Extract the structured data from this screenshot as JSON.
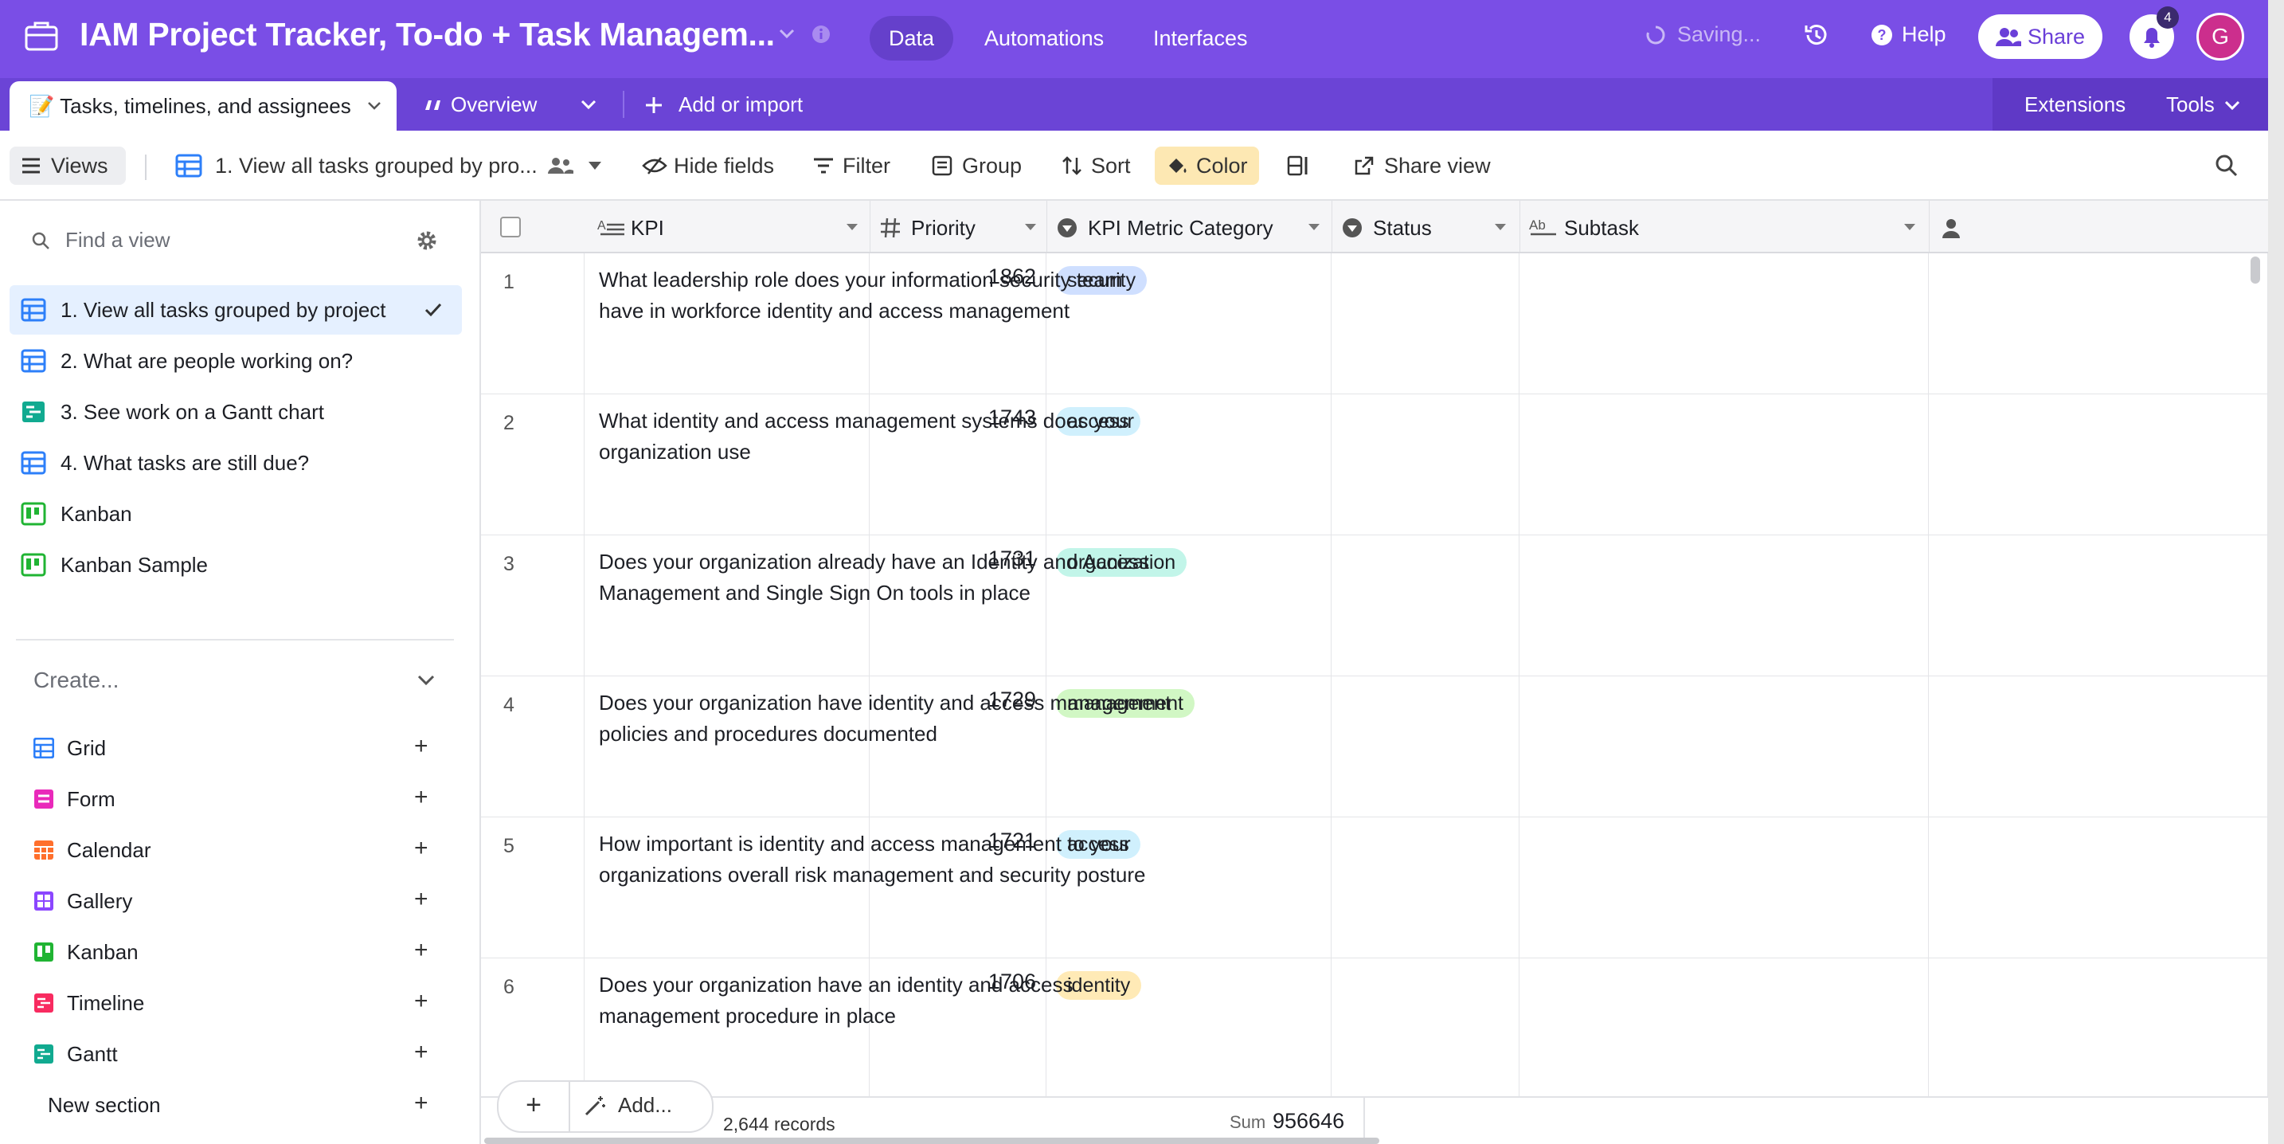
{
  "topbar": {
    "base_title": "IAM Project Tracker, To-do + Task Managem...",
    "nav": [
      "Data",
      "Automations",
      "Interfaces"
    ],
    "saving_text": "Saving...",
    "help_label": "Help",
    "share_label": "Share",
    "notifications_count": "4",
    "avatar_initial": "G",
    "brand_color": "#7a4ee6"
  },
  "tabbar": {
    "active_tab": "📝 Tasks, timelines, and assignees",
    "overview_tab": "Overview",
    "add_import": "Add or import",
    "extensions": "Extensions",
    "tools": "Tools"
  },
  "viewbar": {
    "views_label": "Views",
    "current_view": "1. View all tasks grouped by pro...",
    "hide_fields": "Hide fields",
    "filter": "Filter",
    "group": "Group",
    "sort": "Sort",
    "color": "Color",
    "share_view": "Share view"
  },
  "sidebar": {
    "find_placeholder": "Find a view",
    "views": [
      {
        "label": "1. View all tasks grouped by project",
        "icon": "grid-icon",
        "active": true
      },
      {
        "label": "2. What are people working on?",
        "icon": "grid-icon"
      },
      {
        "label": "3. See work on a Gantt chart",
        "icon": "gantt-icon"
      },
      {
        "label": "4. What tasks are still due?",
        "icon": "grid-icon"
      },
      {
        "label": "Kanban",
        "icon": "kanban-icon"
      },
      {
        "label": "Kanban Sample",
        "icon": "kanban-icon"
      }
    ],
    "create_label": "Create...",
    "create_items": [
      {
        "label": "Grid",
        "color": "#2d7ff9"
      },
      {
        "label": "Form",
        "color": "#e929ba"
      },
      {
        "label": "Calendar",
        "color": "#ff6f2c"
      },
      {
        "label": "Gallery",
        "color": "#8b46ff"
      },
      {
        "label": "Kanban",
        "color": "#20c933"
      },
      {
        "label": "Timeline",
        "color": "#f82b60"
      },
      {
        "label": "Gantt",
        "color": "#20d9d2"
      }
    ],
    "new_section": "New section"
  },
  "grid": {
    "columns": [
      "KPI",
      "Priority",
      "KPI Metric Category",
      "Status",
      "Subtask"
    ],
    "rows": [
      {
        "num": "1",
        "kpi": "What leadership role does your information security team have in workforce identity and access management",
        "priority": "1862",
        "category": "security",
        "color": "#cfdfff"
      },
      {
        "num": "2",
        "kpi": "What identity and access management systems does your organization use",
        "priority": "1743",
        "category": "access",
        "color": "#d0f0fd"
      },
      {
        "num": "3",
        "kpi": "Does your organization already have an Identity and Access Management and Single Sign On tools in place",
        "priority": "1731",
        "category": "organization",
        "color": "#c2f5e9"
      },
      {
        "num": "4",
        "kpi": "Does your organization have identity and access management policies and procedures documented",
        "priority": "1729",
        "category": "management",
        "color": "#d1f7c4"
      },
      {
        "num": "5",
        "kpi": "How important is identity and access management to your organizations overall risk management and security posture",
        "priority": "1721",
        "category": "access",
        "color": "#d0f0fd"
      },
      {
        "num": "6",
        "kpi": "Does your organization have an identity and access management procedure in place",
        "priority": "1706",
        "category": "identity",
        "color": "#ffeab6"
      }
    ],
    "footer": {
      "add_label": "Add...",
      "records": "2,644 records",
      "sum_label": "Sum",
      "sum_value": "956646"
    }
  }
}
